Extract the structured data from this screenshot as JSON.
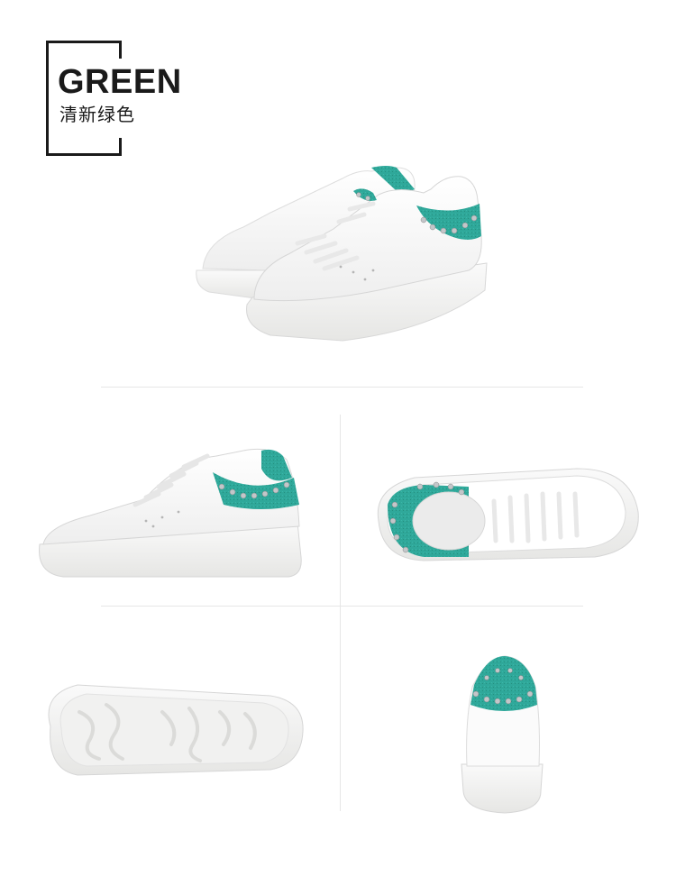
{
  "badge": {
    "title": "GREEN",
    "subtitle": "清新绿色"
  },
  "colors": {
    "accent_suede": "#2fa89a",
    "leather": "#fbfbfb",
    "sole": "#f4f4f2",
    "stud": "#b9bcbf",
    "ink": "#1a1a1a"
  },
  "views": [
    "pair-angle-view",
    "side-view",
    "top-view",
    "sole-view",
    "heel-view"
  ]
}
